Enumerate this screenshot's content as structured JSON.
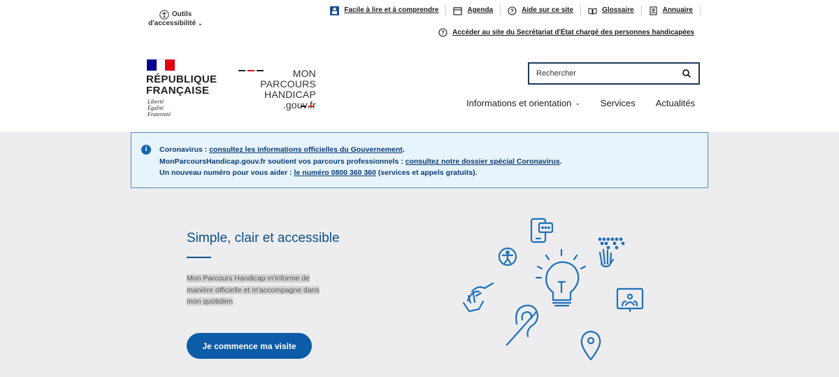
{
  "accessibility_tools": {
    "line1": "Outils",
    "line2": "d'accessibilité"
  },
  "top_links": [
    {
      "label": "Facile à lire et à comprendre",
      "icon": "falc-icon"
    },
    {
      "label": "Agenda",
      "icon": "calendar-icon"
    },
    {
      "label": "Aide sur ce site",
      "icon": "help-icon"
    },
    {
      "label": "Glossaire",
      "icon": "book-icon"
    },
    {
      "label": "Annuaire",
      "icon": "directory-icon"
    }
  ],
  "secretariat_link": "Accéder au site du Secrétariat d'État chargé des personnes handicapées",
  "logo": {
    "rf_line1": "RÉPUBLIQUE",
    "rf_line2": "FRANÇAISE",
    "devise": [
      "Liberté",
      "Égalité",
      "Fraternité"
    ],
    "site_line1": "MON PARCOURS",
    "site_line2": "HANDICAP",
    "site_line3": ".gouv.fr"
  },
  "search": {
    "placeholder": "Rechercher"
  },
  "nav": {
    "info": "Informations et orientation",
    "services": "Services",
    "actualites": "Actualités"
  },
  "info_banner": {
    "l1_prefix": "Coronavirus : ",
    "l1_link": "consultez les informations officielles du Gouvernement",
    "l1_suffix": ".",
    "l2_prefix": "MonParcoursHandicap.gouv.fr soutient vos parcours professionnels : ",
    "l2_link": "consultez notre dossier spécial Coronavirus",
    "l2_suffix": ".",
    "l3_prefix": "Un nouveau numéro pour vous aider : ",
    "l3_link": "le numéro 0800 360 360",
    "l3_suffix": " (services et appels gratuits)."
  },
  "hero": {
    "title": "Simple, clair et accessible",
    "text1": "Mon Parcours Handicap m'informe de",
    "text2": "manière officielle et m'accompagne dans",
    "text3": "mon quotidien",
    "cta": "Je commence ma visite"
  },
  "colors": {
    "primary": "#0d5ca8",
    "marianne_blue": "#000091",
    "marianne_red": "#e1000f",
    "illustration": "#1f6fb8"
  }
}
